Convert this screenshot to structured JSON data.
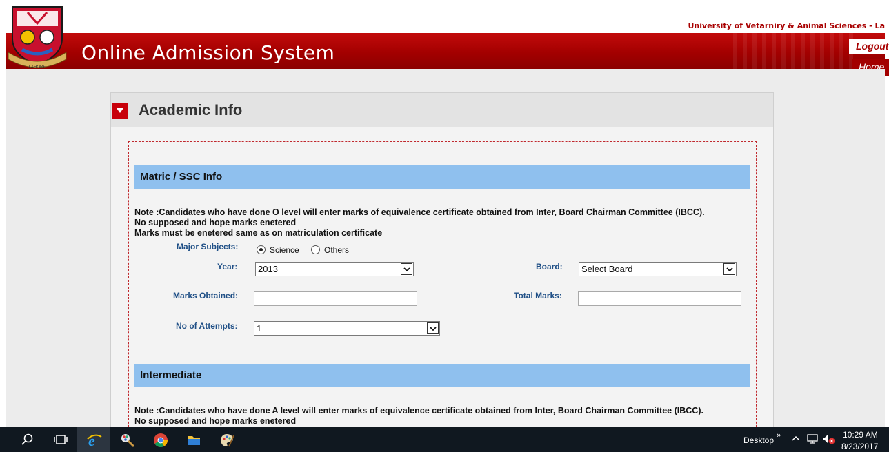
{
  "header": {
    "university_name": "University of Vetarniry & Animal Sciences - La",
    "app_title": "Online Admission System",
    "logo_caption": "LAHORE",
    "logout_label": "Logout",
    "home_label": "Home"
  },
  "panel": {
    "title": "Academic Info"
  },
  "matric": {
    "section_title": "Matric / SSC Info",
    "note_lines": [
      "Note :Candidates who have done O level will enter marks of equivalence certificate obtained from Inter, Board Chairman Committee (IBCC).",
      "No supposed and hope marks enetered",
      "Marks must be enetered same as on matriculation certificate"
    ],
    "major_subjects_label": "Major Subjects:",
    "radio_options": [
      "Science",
      "Others"
    ],
    "selected_radio": "Science",
    "year_label": "Year:",
    "year_value": "2013",
    "board_label": "Board:",
    "board_value": "Select Board",
    "marks_obtained_label": "Marks Obtained:",
    "marks_obtained_value": "",
    "total_marks_label": "Total Marks:",
    "total_marks_value": "",
    "attempts_label": "No of Attempts:",
    "attempts_value": "1"
  },
  "intermediate": {
    "section_title": "Intermediate",
    "note_lines": [
      "Note :Candidates who have done A level will enter marks of equivalence certificate obtained from Inter, Board Chairman Committee (IBCC).",
      "No supposed and hope marks enetered"
    ]
  },
  "taskbar": {
    "icons": [
      "search-icon",
      "task-view-icon",
      "internet-explorer-icon",
      "paint-icon",
      "chrome-icon",
      "file-explorer-icon",
      "paint-palette-icon"
    ],
    "desktop_label": "Desktop",
    "time": "10:29 AM",
    "date": "8/23/2017"
  },
  "colors": {
    "banner_red": "#a30000",
    "section_blue": "#8fc0ee",
    "label_blue": "#1f4f86",
    "dashed_border": "#c0282d"
  }
}
